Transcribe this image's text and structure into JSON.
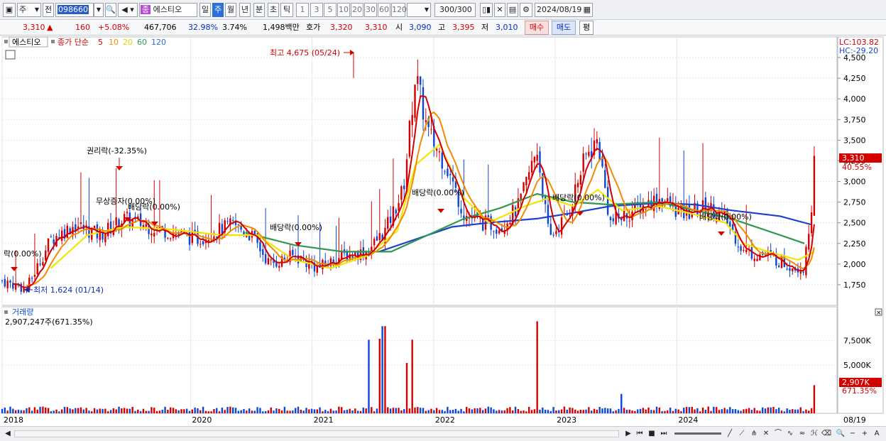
{
  "toolbar": {
    "type_label": "주",
    "prev_label": "전",
    "stock_code": "098660",
    "stock_name": "에스티오",
    "stock_badge": "종",
    "periods": [
      "일",
      "주",
      "월",
      "년",
      "분",
      "초",
      "틱"
    ],
    "selected_period": "주",
    "intervals": [
      "1",
      "3",
      "5",
      "10",
      "20",
      "30",
      "60",
      "120"
    ],
    "count": "300",
    "count_total": "/300",
    "date": "2024/08/19"
  },
  "quote": {
    "price": "3,310",
    "change_arrow": "▲",
    "change": "160",
    "change_pct": "+5.08%",
    "volume": "467,706",
    "vol_ratio": "32.98%",
    "turnover": "3.74%",
    "amount": "1,498백만",
    "ask_label": "호가",
    "ask1": "3,320",
    "ask2": "3,310",
    "open_label": "시",
    "open": "3,090",
    "high_label": "고",
    "high": "3,395",
    "low_label": "저",
    "low": "3,010",
    "buy_label": "매수",
    "sell_label": "매도",
    "flat_label": "평"
  },
  "legend": {
    "stock_name": "에스티오",
    "ma_title": "종가 단순",
    "ma5": "5",
    "ma10": "10",
    "ma20": "20",
    "ma60": "60",
    "ma120": "120"
  },
  "indicators": {
    "lc": "LC:103.82",
    "hc": "HC:-29.20",
    "price_tag": "3,310",
    "pct_tag": "40.55%"
  },
  "annotations": {
    "high": "최고 4,675 (05/24)",
    "low": "최저 1,624 (01/14)",
    "rights": "권리락(-32.35%)",
    "bonus": "무상증자(0.00%)",
    "div_2019": "배당락(0.00%)",
    "div_left": "락(0.00%)",
    "div_2020": "배당락(0.00%)",
    "div_2021": "배당락(0.00%)",
    "div_2022": "배당락(0.00%)",
    "div_2023": "배당락(0.00%)"
  },
  "volume_panel": {
    "title": "거래량",
    "value": "2,907,247주(671.35%)",
    "tag_value": "2,907K",
    "tag_pct": "671.35%"
  },
  "colors": {
    "ma5": "#d40000",
    "ma10": "#f08c00",
    "ma20": "#f2e600",
    "ma60": "#2f9a4f",
    "ma120": "#1f3fcf",
    "up": "#d40000",
    "down": "#0d47d8"
  },
  "chart_data": {
    "type": "candlestick",
    "y_ticks": [
      "4,500",
      "4,250",
      "4,000",
      "3,750",
      "3,500",
      "3,250",
      "3,000",
      "2,750",
      "2,500",
      "2,250",
      "2,000",
      "1,750"
    ],
    "ylim": [
      1500,
      4750
    ],
    "x_ticks": [
      "2018",
      "2020",
      "2021",
      "2022",
      "2023",
      "2024",
      "08/19"
    ],
    "volume_ticks": [
      "7,500K",
      "5,000K"
    ],
    "price_path": [
      [
        2018.0,
        1800
      ],
      [
        2018.2,
        1700
      ],
      [
        2018.4,
        2300
      ],
      [
        2018.6,
        2480
      ],
      [
        2018.8,
        2350
      ],
      [
        2019.0,
        2550
      ],
      [
        2019.3,
        2420
      ],
      [
        2019.6,
        2300
      ],
      [
        2019.9,
        2480
      ],
      [
        2020.05,
        2350
      ],
      [
        2020.2,
        2000
      ],
      [
        2020.4,
        2100
      ],
      [
        2020.6,
        1950
      ],
      [
        2020.8,
        2100
      ],
      [
        2021.0,
        2150
      ],
      [
        2021.15,
        2400
      ],
      [
        2021.3,
        2900
      ],
      [
        2021.4,
        4300
      ],
      [
        2021.5,
        3600
      ],
      [
        2021.65,
        3200
      ],
      [
        2021.8,
        2600
      ],
      [
        2021.95,
        2500
      ],
      [
        2022.1,
        2450
      ],
      [
        2022.25,
        2700
      ],
      [
        2022.4,
        3400
      ],
      [
        2022.5,
        2300
      ],
      [
        2022.65,
        2600
      ],
      [
        2022.8,
        3300
      ],
      [
        2022.9,
        3500
      ],
      [
        2023.0,
        2500
      ],
      [
        2023.2,
        2650
      ],
      [
        2023.4,
        2800
      ],
      [
        2023.6,
        2600
      ],
      [
        2023.8,
        2700
      ],
      [
        2023.95,
        2550
      ],
      [
        2024.1,
        2150
      ],
      [
        2024.3,
        2100
      ],
      [
        2024.45,
        2000
      ],
      [
        2024.6,
        1950
      ],
      [
        2024.7,
        3310
      ]
    ],
    "ma60_path": [
      [
        2020.0,
        2380
      ],
      [
        2020.4,
        2230
      ],
      [
        2020.8,
        2150
      ],
      [
        2021.2,
        2150
      ],
      [
        2021.5,
        2350
      ],
      [
        2021.8,
        2550
      ],
      [
        2022.1,
        2680
      ],
      [
        2022.4,
        2850
      ],
      [
        2022.7,
        2750
      ],
      [
        2023.0,
        2720
      ],
      [
        2023.4,
        2750
      ],
      [
        2023.7,
        2650
      ],
      [
        2024.0,
        2550
      ],
      [
        2024.4,
        2350
      ],
      [
        2024.6,
        2250
      ]
    ],
    "ma120_path": [
      [
        2021.1,
        2150
      ],
      [
        2021.4,
        2300
      ],
      [
        2021.7,
        2450
      ],
      [
        2022.0,
        2500
      ],
      [
        2022.4,
        2550
      ],
      [
        2022.7,
        2620
      ],
      [
        2023.0,
        2700
      ],
      [
        2023.4,
        2740
      ],
      [
        2023.7,
        2720
      ],
      [
        2024.0,
        2650
      ],
      [
        2024.4,
        2580
      ],
      [
        2024.65,
        2480
      ]
    ],
    "ma20_path": [
      [
        2018.4,
        1950
      ],
      [
        2018.7,
        2350
      ],
      [
        2019.0,
        2450
      ],
      [
        2019.4,
        2420
      ],
      [
        2019.8,
        2350
      ],
      [
        2020.1,
        2350
      ],
      [
        2020.4,
        2050
      ],
      [
        2020.7,
        1950
      ],
      [
        2021.0,
        2100
      ],
      [
        2021.25,
        2400
      ],
      [
        2021.4,
        3200
      ],
      [
        2021.6,
        3450
      ],
      [
        2021.8,
        2800
      ],
      [
        2022.0,
        2500
      ],
      [
        2022.3,
        2700
      ],
      [
        2022.5,
        2800
      ],
      [
        2022.7,
        2700
      ],
      [
        2022.9,
        2900
      ],
      [
        2023.1,
        2650
      ],
      [
        2023.4,
        2700
      ],
      [
        2023.7,
        2600
      ],
      [
        2023.95,
        2500
      ],
      [
        2024.1,
        2250
      ],
      [
        2024.3,
        2150
      ],
      [
        2024.55,
        2050
      ],
      [
        2024.68,
        2150
      ]
    ],
    "volume_spikes": [
      [
        2021.02,
        7600
      ],
      [
        2021.1,
        7700
      ],
      [
        2021.14,
        9000
      ],
      [
        2021.33,
        5200
      ],
      [
        2021.37,
        7600
      ],
      [
        2022.4,
        9500
      ],
      [
        2023.1,
        2000
      ],
      [
        2024.68,
        2907
      ]
    ]
  }
}
